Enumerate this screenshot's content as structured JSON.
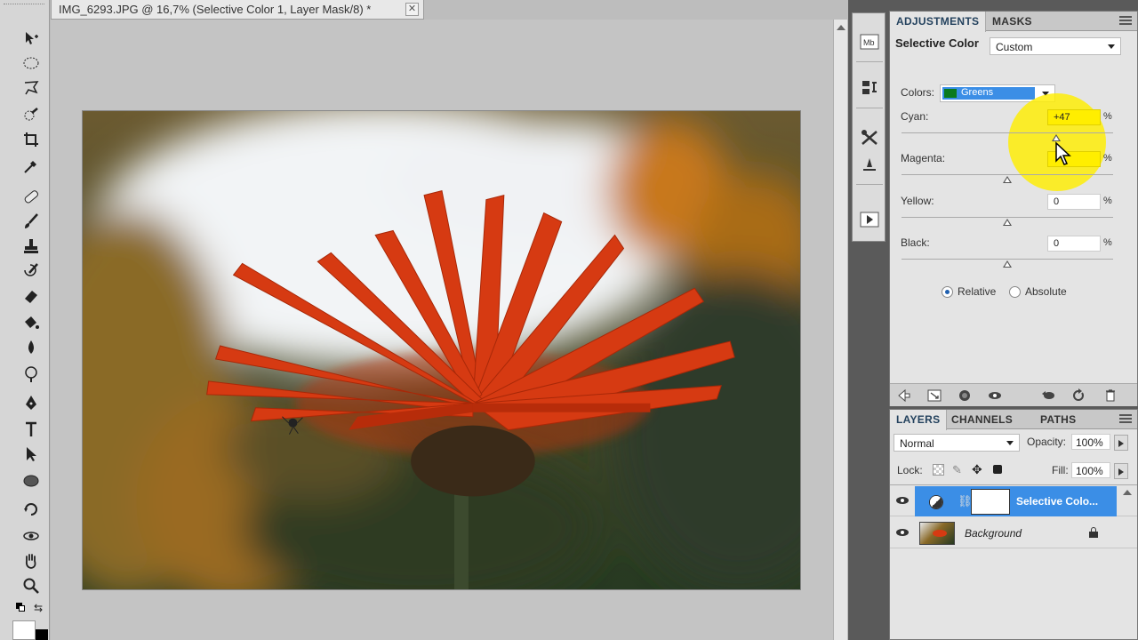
{
  "document": {
    "tab_title": "IMG_6293.JPG @ 16,7% (Selective Color 1, Layer Mask/8) *",
    "close_glyph": "✕"
  },
  "tools": [
    "move-tool",
    "marquee-tool",
    "lasso-tool",
    "quick-selection-tool",
    "crop-tool",
    "eyedropper-tool",
    "healing-brush-tool",
    "brush-tool",
    "clone-stamp-tool",
    "history-brush-tool",
    "eraser-tool",
    "paint-bucket-tool",
    "blur-tool",
    "dodge-tool",
    "pen-tool",
    "type-tool",
    "path-selection-tool",
    "ellipse-tool",
    "3d-rotate-tool",
    "3d-orbit-tool",
    "hand-tool",
    "zoom-tool"
  ],
  "adjustments": {
    "tabs": [
      "ADJUSTMENTS",
      "MASKS"
    ],
    "title": "Selective Color",
    "preset": "Custom",
    "colors_label": "Colors:",
    "colors_value": "Greens",
    "colors_swatch": "#0a7a1e",
    "sliders": [
      {
        "label": "Cyan:",
        "value": "+47",
        "percent": "%",
        "level": 47
      },
      {
        "label": "Magenta:",
        "value": "",
        "percent": "%",
        "level": 0
      },
      {
        "label": "Yellow:",
        "value": "0",
        "percent": "%",
        "level": 0
      },
      {
        "label": "Black:",
        "value": "0",
        "percent": "%",
        "level": 0
      }
    ],
    "method_relative": "Relative",
    "method_absolute": "Absolute",
    "highlight_color": "#ffee00"
  },
  "layers": {
    "tabs": [
      "LAYERS",
      "CHANNELS",
      "PATHS"
    ],
    "blend_mode": "Normal",
    "opacity_label": "Opacity:",
    "opacity_value": "100%",
    "lock_label": "Lock:",
    "fill_label": "Fill:",
    "fill_value": "100%",
    "items": [
      {
        "name": "Selective Colo...",
        "selected": true
      },
      {
        "name": "Background",
        "selected": false
      }
    ]
  }
}
